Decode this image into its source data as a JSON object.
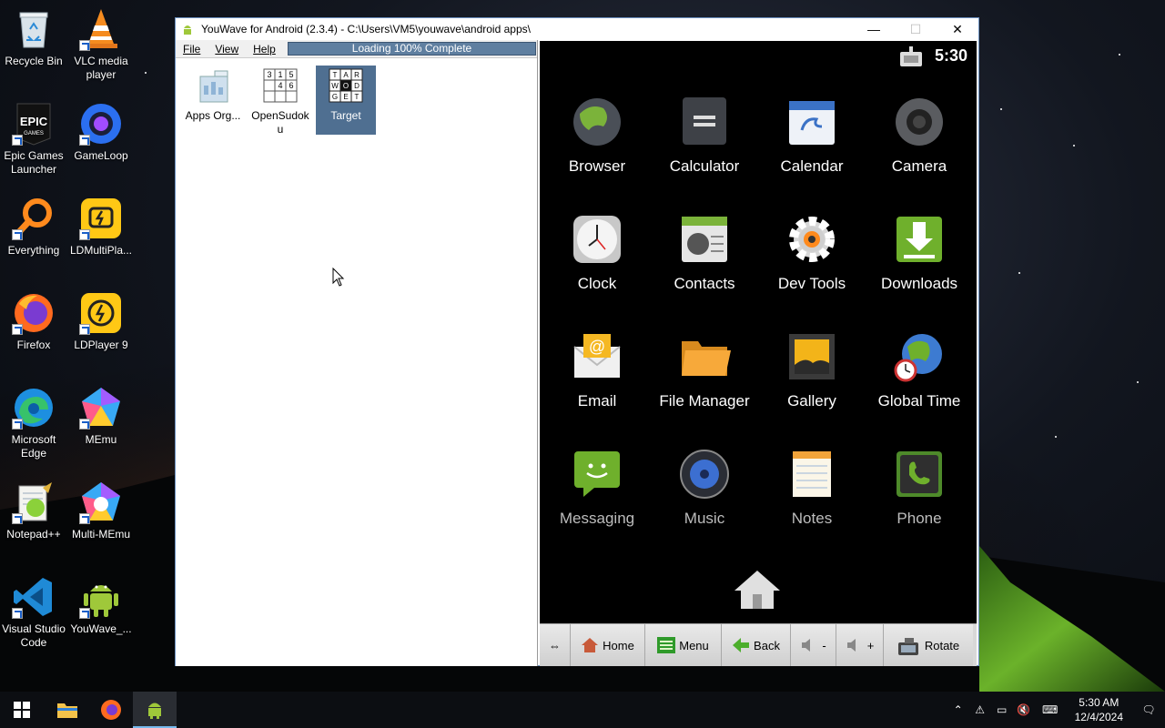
{
  "desktop": {
    "icons": [
      {
        "label": "Recycle Bin"
      },
      {
        "label": "VLC media player"
      },
      {
        "label": "Epic Games Launcher"
      },
      {
        "label": "GameLoop"
      },
      {
        "label": "Everything"
      },
      {
        "label": "LDMultiPla..."
      },
      {
        "label": "Firefox"
      },
      {
        "label": "LDPlayer 9"
      },
      {
        "label": "Microsoft Edge"
      },
      {
        "label": "MEmu"
      },
      {
        "label": "Notepad++"
      },
      {
        "label": "Multi-MEmu"
      },
      {
        "label": "Visual Studio Code"
      },
      {
        "label": "YouWave_..."
      }
    ]
  },
  "window": {
    "title": "YouWave for Android (2.3.4) - C:\\Users\\VM5\\youwave\\android apps\\",
    "controls": {
      "minimize": "—",
      "maximize": "☐",
      "close": "✕"
    }
  },
  "menubar": {
    "items": [
      {
        "label": "File"
      },
      {
        "label": "View"
      },
      {
        "label": "Help"
      }
    ],
    "progress_text": "Loading 100% Complete",
    "progress_value": 1.0
  },
  "apps_list": [
    {
      "label": "Apps Org...",
      "selected": false
    },
    {
      "label": "OpenSudoku",
      "selected": false
    },
    {
      "label": "Target",
      "selected": true
    }
  ],
  "sudoku_digits": [
    "1",
    "5",
    "4",
    "6",
    "3"
  ],
  "target_letters": [
    "T",
    "A",
    "R",
    "W",
    "O",
    "D",
    "G",
    "E",
    "T"
  ],
  "android": {
    "time": "5:30",
    "apps": [
      {
        "label": "Browser"
      },
      {
        "label": "Calculator"
      },
      {
        "label": "Calendar"
      },
      {
        "label": "Camera"
      },
      {
        "label": "Clock"
      },
      {
        "label": "Contacts"
      },
      {
        "label": "Dev Tools"
      },
      {
        "label": "Downloads"
      },
      {
        "label": "Email"
      },
      {
        "label": "File Manager"
      },
      {
        "label": "Gallery"
      },
      {
        "label": "Global Time"
      },
      {
        "label": "Messaging"
      },
      {
        "label": "Music"
      },
      {
        "label": "Notes"
      },
      {
        "label": "Phone"
      }
    ],
    "nav": {
      "home": "Home",
      "menu": "Menu",
      "back": "Back",
      "vol_down": "-",
      "vol_up": "+",
      "rotate": "Rotate"
    }
  },
  "taskbar": {
    "time": "5:30 AM",
    "date": "12/4/2024"
  }
}
